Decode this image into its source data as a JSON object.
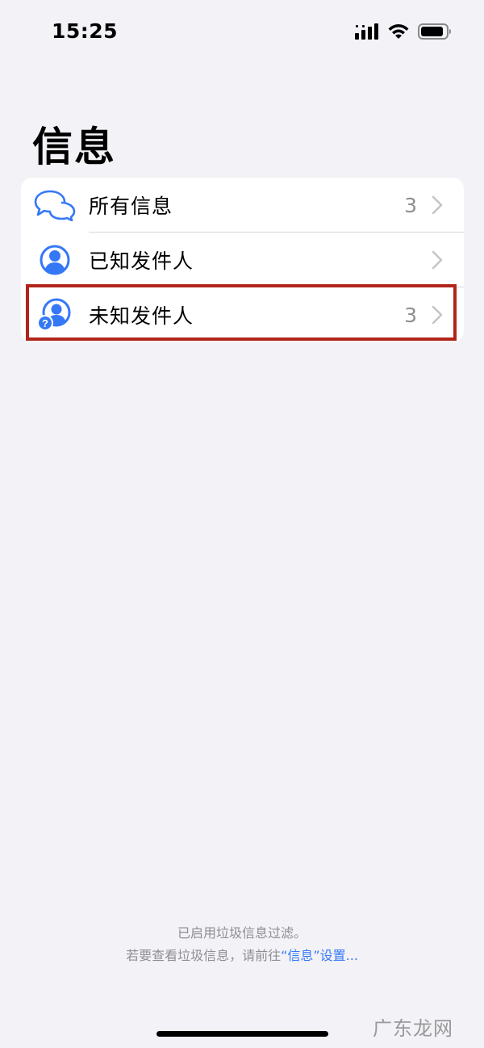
{
  "status_bar": {
    "time": "15:25",
    "icons": [
      "cellular-signal-icon",
      "wifi-icon",
      "battery-icon"
    ]
  },
  "page": {
    "title": "信息"
  },
  "filters": [
    {
      "icon": "chat-bubbles-icon",
      "label": "所有信息",
      "count": "3",
      "selected": false
    },
    {
      "icon": "person-circle-icon",
      "label": "已知发件人",
      "count": "",
      "selected": false
    },
    {
      "icon": "person-question-icon",
      "label": "未知发件人",
      "count": "3",
      "selected": true
    }
  ],
  "footer": {
    "line1": "已启用垃圾信息过滤。",
    "line2_prefix": "若要查看垃圾信息，请前往",
    "line2_link": "“信息”设置",
    "line2_suffix": "..."
  },
  "watermark": "广东龙网",
  "colors": {
    "background": "#f2f2f7",
    "accent": "#3478f6",
    "highlight": "#b22419",
    "secondary_text": "#8e8e93"
  }
}
